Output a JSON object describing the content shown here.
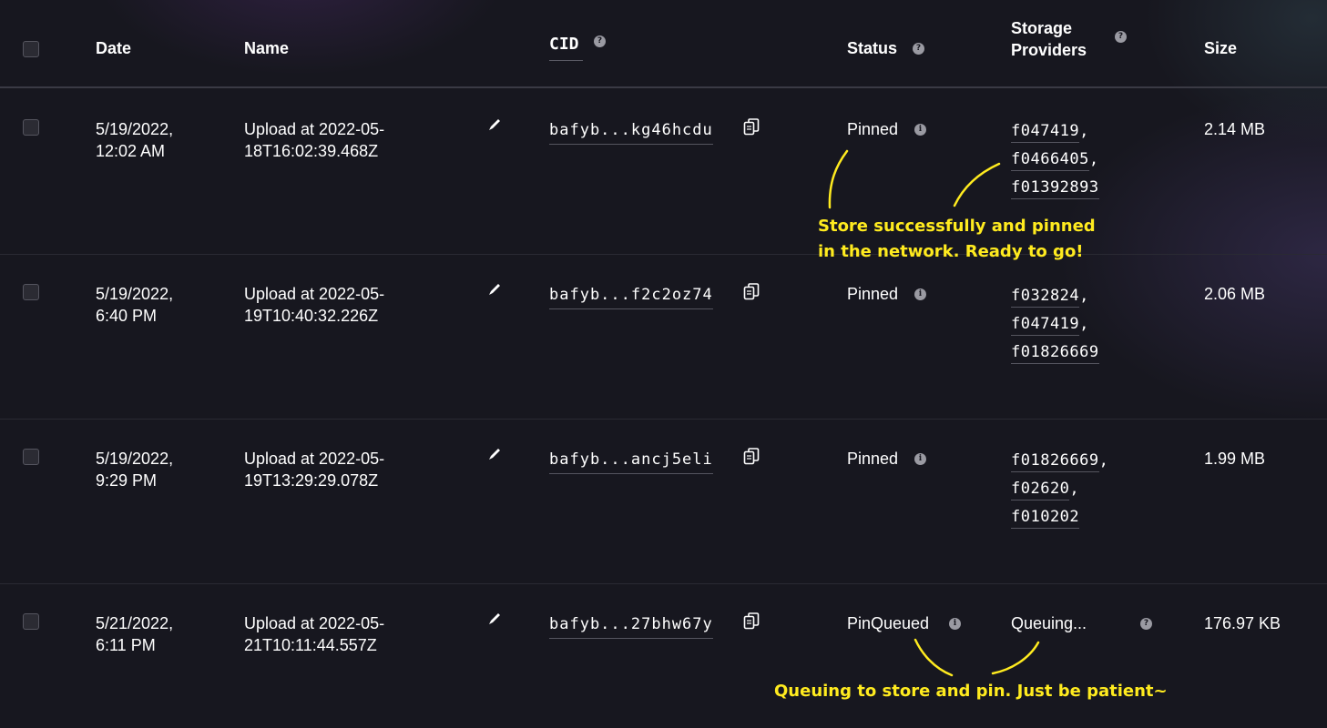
{
  "header": {
    "date": "Date",
    "name": "Name",
    "cid": "CID",
    "status": "Status",
    "storage_providers_line1": "Storage",
    "storage_providers_line2": "Providers",
    "size": "Size",
    "help_glyph": "?"
  },
  "rows": [
    {
      "date_line1": "5/19/2022,",
      "date_line2": "12:02 AM",
      "name_line1": "Upload at 2022-05-",
      "name_line2": "18T16:02:39.468Z",
      "cid": "bafyb...kg46hcdu",
      "status": "Pinned",
      "providers": [
        "f047419",
        "f0466405",
        "f01392893"
      ],
      "size": "2.14 MB"
    },
    {
      "date_line1": "5/19/2022,",
      "date_line2": "6:40 PM",
      "name_line1": "Upload at 2022-05-",
      "name_line2": "19T10:40:32.226Z",
      "cid": "bafyb...f2c2oz74",
      "status": "Pinned",
      "providers": [
        "f032824",
        "f047419",
        "f01826669"
      ],
      "size": "2.06 MB"
    },
    {
      "date_line1": "5/19/2022,",
      "date_line2": "9:29 PM",
      "name_line1": "Upload at 2022-05-",
      "name_line2": "19T13:29:29.078Z",
      "cid": "bafyb...ancj5eli",
      "status": "Pinned",
      "providers": [
        "f01826669",
        "f02620",
        "f010202"
      ],
      "size": "1.99 MB"
    },
    {
      "date_line1": "5/21/2022,",
      "date_line2": "6:11 PM",
      "name_line1": "Upload at 2022-05-",
      "name_line2": "21T10:11:44.557Z",
      "cid": "bafyb...27bhw67y",
      "status": "PinQueued",
      "providers_text": "Queuing...",
      "size": "176.97 KB"
    }
  ],
  "annotations": {
    "pinned_line1": "Store successfully and pinned",
    "pinned_line2": "in the network. Ready to go!",
    "queued": "Queuing to store and pin. Just be patient~"
  },
  "colors": {
    "background": "#17171f",
    "annotation": "#ffeb1f",
    "text": "#ffffff"
  },
  "icons": {
    "edit": "pencil-icon",
    "copy": "copy-icon",
    "info": "info-icon",
    "help": "help-icon"
  }
}
